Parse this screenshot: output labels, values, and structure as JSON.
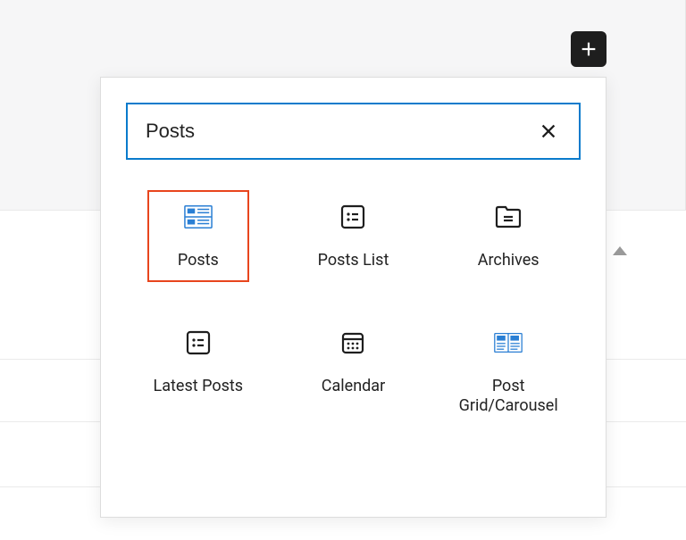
{
  "search": {
    "value": "Posts"
  },
  "blocks": [
    {
      "label": "Posts"
    },
    {
      "label": "Posts List"
    },
    {
      "label": "Archives"
    },
    {
      "label": "Latest Posts"
    },
    {
      "label": "Calendar"
    },
    {
      "label": "Post\nGrid/Carousel"
    }
  ]
}
